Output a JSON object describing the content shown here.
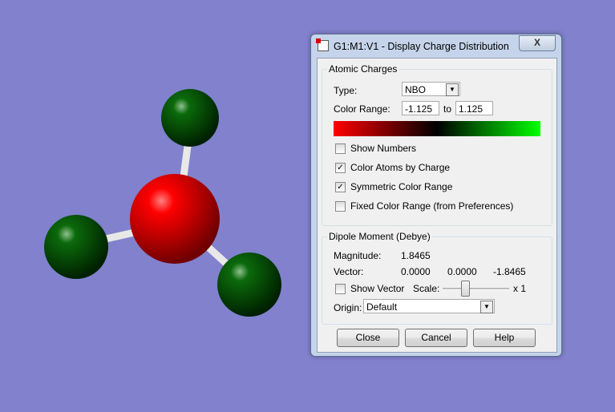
{
  "dialog": {
    "title": "G1:M1:V1 - Display Charge Distribution",
    "close_glyph": "X"
  },
  "atomic": {
    "legend": "Atomic Charges",
    "type_label": "Type:",
    "type_value": "NBO",
    "range_label": "Color Range:",
    "range_min": "-1.125",
    "to_label": "to",
    "range_max": "1.125",
    "checkboxes": [
      {
        "label": "Show Numbers",
        "checked": false
      },
      {
        "label": "Color Atoms by Charge",
        "checked": true
      },
      {
        "label": "Symmetric Color Range",
        "checked": true
      },
      {
        "label": "Fixed Color Range (from Preferences)",
        "checked": false
      }
    ]
  },
  "dipole": {
    "legend": "Dipole Moment (Debye)",
    "magnitude_label": "Magnitude:",
    "magnitude": "1.8465",
    "vector_label": "Vector:",
    "vx": "0.0000",
    "vy": "0.0000",
    "vz": "-1.8465",
    "show_vector_label": "Show Vector",
    "show_vector_checked": false,
    "scale_label": "Scale:",
    "scale_value": "x 1",
    "origin_label": "Origin:",
    "origin_value": "Default"
  },
  "buttons": {
    "close": "Close",
    "cancel": "Cancel",
    "help": "Help"
  },
  "colors": {
    "negative": "#ff0000",
    "neutral": "#000000",
    "positive": "#00ff00",
    "background": "#8181cd"
  }
}
